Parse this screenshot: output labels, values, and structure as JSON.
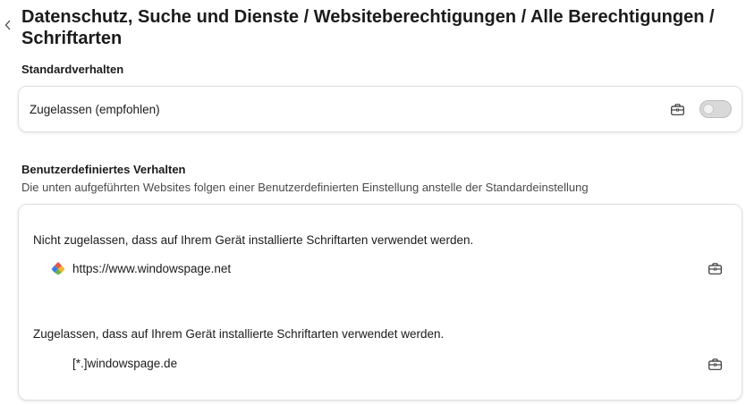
{
  "header": {
    "title": "Datenschutz, Suche und Dienste / Websiteberechtigungen / Alle Berechtigungen / Schriftarten"
  },
  "default_section": {
    "heading": "Standardverhalten",
    "row_label": "Zugelassen (empfohlen)",
    "toggle_on": false
  },
  "custom_section": {
    "heading": "Benutzerdefiniertes Verhalten",
    "description": "Die unten aufgeführten Websites folgen einer Benutzerdefinierten Einstellung anstelle der Standardeinstellung",
    "blocked": {
      "label": "Nicht zugelassen, dass auf Ihrem Gerät installierte Schriftarten verwendet werden.",
      "sites": [
        "https://www.windowspage.net"
      ]
    },
    "allowed": {
      "label": "Zugelassen, dass auf Ihrem Gerät installierte Schriftarten verwendet werden.",
      "sites": [
        "[*.]windowspage.de"
      ]
    }
  },
  "icons": {
    "back": "chevron-left-icon",
    "policy": "briefcase-icon",
    "favicon": "windowspage-favicon-icon"
  }
}
